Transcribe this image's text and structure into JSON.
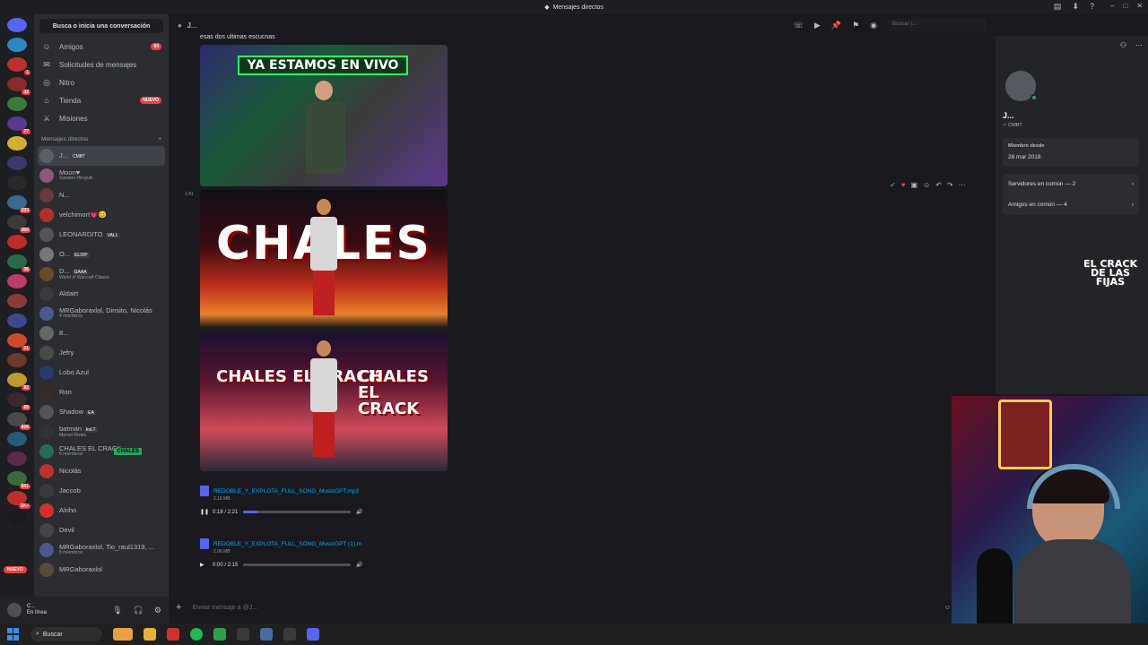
{
  "window": {
    "title": "Mensajes directos"
  },
  "sidebar": {
    "search_label": "Busca o inicia una conversación",
    "nav": [
      {
        "label": "Amigos",
        "icon": "friends-icon",
        "badge": "64"
      },
      {
        "label": "Solicitudes de mensajes",
        "icon": "message-request-icon",
        "badge": ""
      },
      {
        "label": "Nitro",
        "icon": "nitro-icon",
        "badge": ""
      },
      {
        "label": "Tienda",
        "icon": "shop-icon",
        "badge": "NUEVO"
      },
      {
        "label": "Misiones",
        "icon": "quest-icon",
        "badge": ""
      }
    ],
    "dm_header": "Mensajes directos",
    "dms": [
      {
        "name": "J...",
        "tag": "CMBT",
        "sub": "",
        "color": "#5a5f66"
      },
      {
        "name": "Moon♥",
        "tag": "",
        "sub": "Sawano Hiroyuki",
        "color": "#8a5a7a"
      },
      {
        "name": "N...",
        "tag": "",
        "sub": "",
        "color": "#6a3a3a"
      },
      {
        "name": "velchimort💗😊",
        "tag": "",
        "sub": "",
        "color": "#b03030"
      },
      {
        "name": "LEONARDITO",
        "tag": "VALL",
        "sub": "",
        "color": "#555"
      },
      {
        "name": "O...",
        "tag": "ELIDP",
        "sub": "",
        "color": "#777"
      },
      {
        "name": "D...",
        "tag": "GAAA",
        "sub": "World of Warcraft Classic",
        "color": "#6a4a2a"
      },
      {
        "name": "Aldairt",
        "tag": "",
        "sub": "",
        "color": "#3a3a3a"
      },
      {
        "name": "MRGaboraxlol, Dinsito, Nicolás",
        "tag": "",
        "sub": "4 miembros",
        "color": "#4a5a8a"
      },
      {
        "name": "8...",
        "tag": "",
        "sub": "",
        "color": "#666"
      },
      {
        "name": "Jefry",
        "tag": "",
        "sub": "",
        "color": "#4a4a4a"
      },
      {
        "name": "Lobo Azul",
        "tag": "",
        "sub": "",
        "color": "#2a3a6a"
      },
      {
        "name": "Ron",
        "tag": "",
        "sub": "",
        "color": "#3a2a2a"
      },
      {
        "name": "Shadow",
        "tag": "EA",
        "sub": "",
        "color": "#555"
      },
      {
        "name": "batman",
        "tag": "kvLT",
        "sub": "Marvel Rivals",
        "color": "#333"
      },
      {
        "name": "CHALES EL CRACK",
        "tag": "",
        "sub": "5 miembros",
        "color": "#2a6a5a"
      },
      {
        "name": "Nicolás",
        "tag": "",
        "sub": "",
        "color": "#c03030"
      },
      {
        "name": "Jaccob",
        "tag": "",
        "sub": "",
        "color": "#3a3a3a"
      },
      {
        "name": "Alriho",
        "tag": "",
        "sub": "",
        "color": "#d03030"
      },
      {
        "name": "Devil",
        "tag": "",
        "sub": "",
        "color": "#444"
      },
      {
        "name": "MRGaboraxlol, Tio_raul1319, ...",
        "tag": "",
        "sub": "5 miembros",
        "color": "#4a5a8a"
      },
      {
        "name": "MRGaboraxlol",
        "tag": "",
        "sub": "",
        "color": "#5a4a3a"
      }
    ],
    "chales_badge": "CHALES",
    "user": {
      "name": "C...",
      "status": "En línea"
    }
  },
  "rail": {
    "nuevo": "NUEVO"
  },
  "chat": {
    "header_name": "J...",
    "search_placeholder": "Buscar |...",
    "message_text": "esas dos ultimas escucnas",
    "thumb1_banner": "YA ESTAMOS EN VIVO",
    "thumb2_text": "CHALES",
    "thumb3_left": "CHALES EL CRACK",
    "thumb3_right": "CHALES EL CRACK",
    "timestamp": "1:41",
    "audio": [
      {
        "file": "REDOBLE_Y_EXPLOTA_FULL_SONG_MusicGPT.mp3",
        "size": "2.16 MB",
        "time": "0:18 / 2:21",
        "progress": 0.13,
        "state": "pause"
      },
      {
        "file": "REDOBLE_Y_EXPLOTA_FULL_SONG_MusicGPT (1).m",
        "size": "2.06 MB",
        "time": "0:00 / 2:15",
        "progress": 0.0,
        "state": "play"
      }
    ],
    "composer_placeholder": "Enviar mensaje a @J..."
  },
  "profile": {
    "name": "J...",
    "tag": "CMBT",
    "member_since_label": "Miembro desde",
    "member_since": "28 mar 2018",
    "servers_common": "Servidores en común — 2",
    "friends_common": "Amigos en común — 4"
  },
  "overlay": {
    "logo_text": "EL CRACK DE LAS FIJAS"
  },
  "taskbar": {
    "search": "Buscar"
  }
}
